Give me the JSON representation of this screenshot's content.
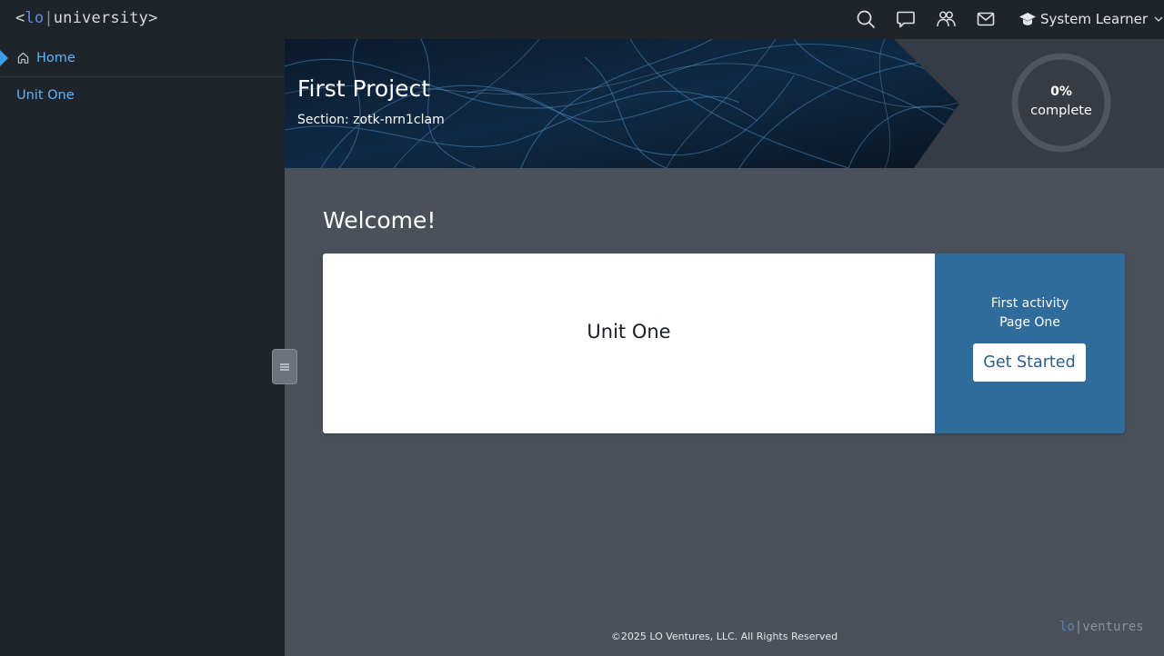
{
  "header": {
    "logo": {
      "lt": "<",
      "lo": "lo",
      "sep": "|",
      "name": "university",
      "gt": ">"
    },
    "icons": [
      "search-icon",
      "chat-icon",
      "people-icon",
      "mail-icon"
    ],
    "user": {
      "icon": "graduation-cap-icon",
      "name": "System Learner"
    }
  },
  "sidebar": {
    "items": [
      {
        "label": "Home",
        "icon": "home-icon",
        "active": true
      },
      {
        "label": "Unit One"
      }
    ],
    "toggle_icon": "hamburger-icon"
  },
  "banner": {
    "title": "First Project",
    "section": "Section: zotk-nrn1clam",
    "progress": {
      "value": 0,
      "percent_text": "0%",
      "label": "complete"
    }
  },
  "main": {
    "heading": "Welcome!",
    "unit_card": {
      "title": "Unit One",
      "activity_line1": "First activity",
      "activity_line2": "Page One",
      "button": "Get Started"
    }
  },
  "footer": {
    "copyright": "©2025 LO Ventures, LLC. All Rights Reserved",
    "brand": {
      "lo": "lo",
      "sep": "|",
      "name": "ventures"
    }
  },
  "colors": {
    "topbar": "#1f242b",
    "sidebar": "#1f242b",
    "content_bg": "#4a515a",
    "link": "#5cb6ff",
    "card_accent": "#2f6b9b"
  }
}
